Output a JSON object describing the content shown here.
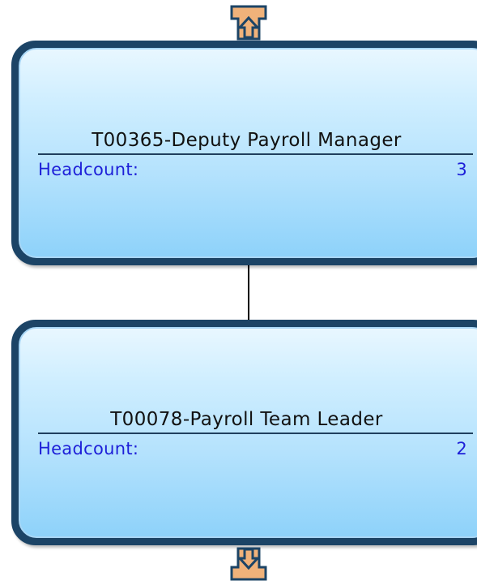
{
  "nodes": [
    {
      "title": "T00365-Deputy Payroll Manager",
      "field_label": "Headcount:",
      "field_value": "3"
    },
    {
      "title": "T00078-Payroll Team Leader",
      "field_label": "Headcount:",
      "field_value": "2"
    }
  ],
  "colors": {
    "node_border": "#1c4466",
    "node_fill_top": "#e8f7ff",
    "node_fill_bottom": "#8ed2fa",
    "field_text": "#1d1fd8",
    "arrow_fill": "#f0b27a",
    "arrow_stroke": "#1c4466"
  },
  "icons": {
    "expand_up": "arrow-up-icon",
    "expand_down": "arrow-down-icon"
  }
}
